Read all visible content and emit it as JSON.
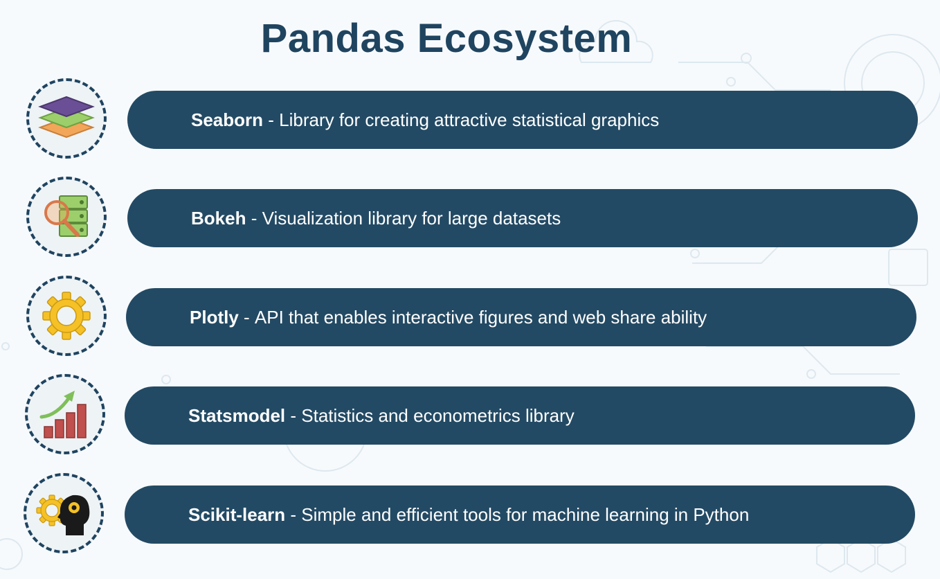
{
  "title": "Pandas Ecosystem",
  "items": [
    {
      "name": "Seaborn",
      "separator": " - ",
      "description": "Library for creating attractive statistical graphics",
      "icon": "layers-icon"
    },
    {
      "name": "Bokeh",
      "separator": " - ",
      "description": "Visualization library for large datasets",
      "icon": "server-magnifier-icon"
    },
    {
      "name": "Plotly",
      "separator": " - ",
      "description": "API that enables interactive figures and web share ability",
      "icon": "gear-icon"
    },
    {
      "name": "Statsmodel",
      "separator": " - ",
      "description": "Statistics and econometrics library",
      "icon": "bar-chart-growth-icon"
    },
    {
      "name": "Scikit-learn",
      "separator": " - ",
      "description": "Simple and efficient tools for machine learning in Python",
      "icon": "gear-head-icon"
    }
  ],
  "colors": {
    "title": "#1f4460",
    "pill": "#234a64",
    "pill_text": "#ffffff",
    "icon_border": "#1f4460",
    "background": "#f7fafc"
  }
}
